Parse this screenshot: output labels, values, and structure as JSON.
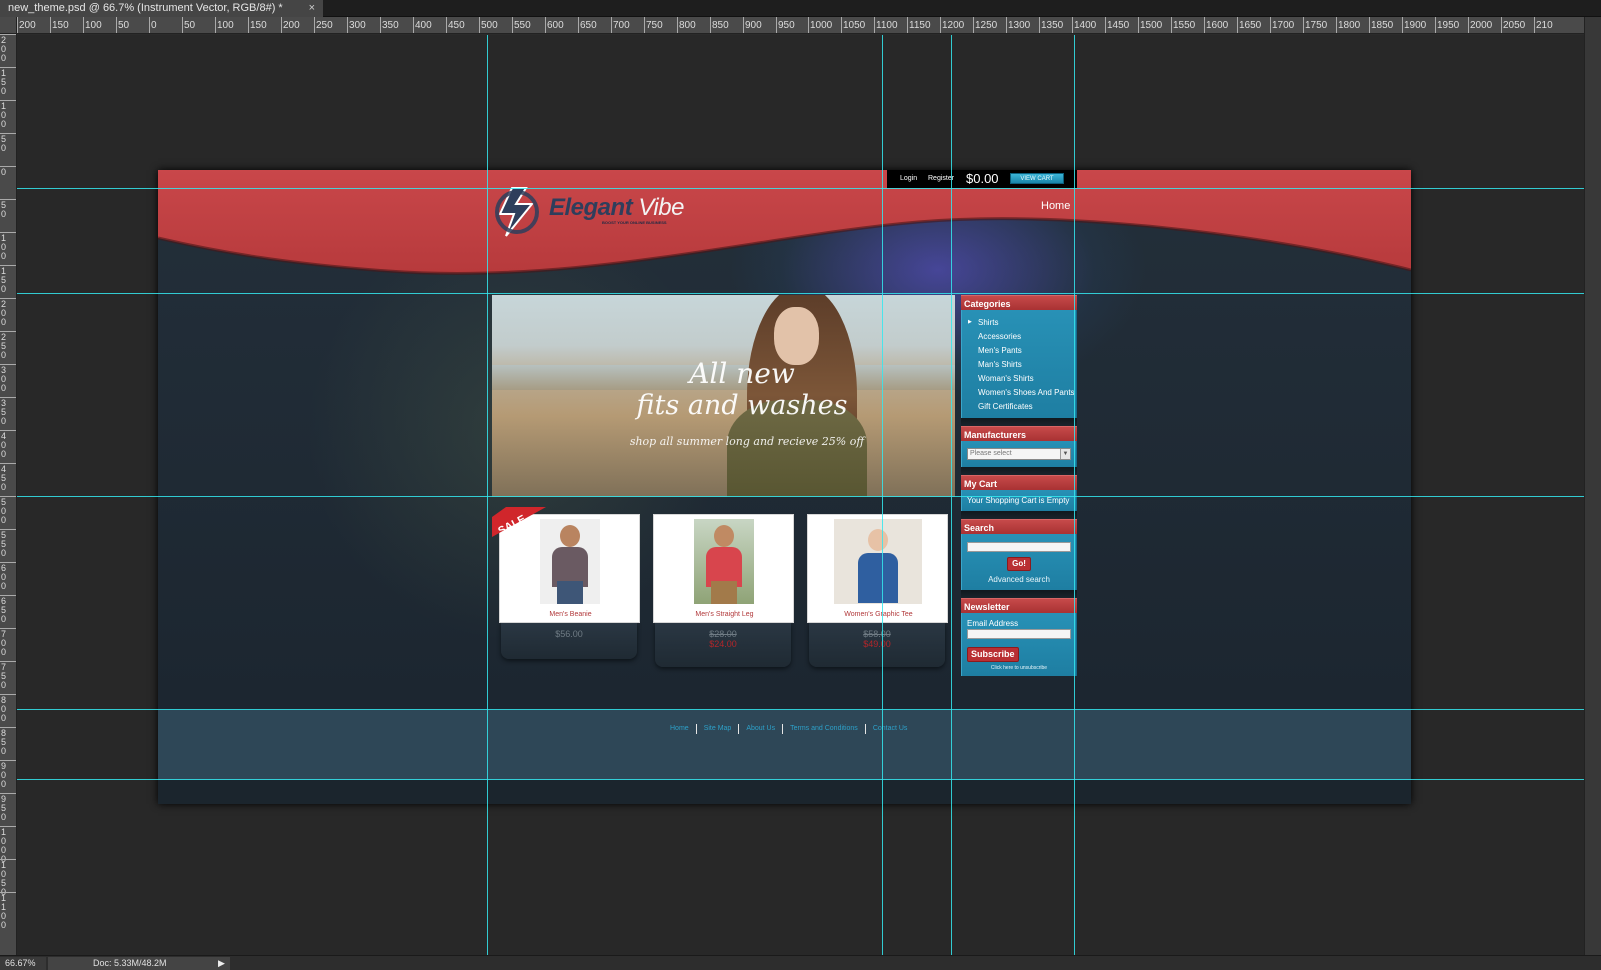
{
  "document": {
    "tab_title": "new_theme.psd @ 66.7% (Instrument Vector, RGB/8#) *",
    "close_glyph": "×"
  },
  "rulers": {
    "horizontal_labels": [
      "200",
      "150",
      "100",
      "50",
      "0",
      "50",
      "100",
      "150",
      "200",
      "250",
      "300",
      "350",
      "400",
      "450",
      "500",
      "550",
      "600",
      "650",
      "700",
      "750",
      "800",
      "850",
      "900",
      "950",
      "1000",
      "1050",
      "1100",
      "1150",
      "1200",
      "1250",
      "1300",
      "1350",
      "1400",
      "1450",
      "1500",
      "1550",
      "1600",
      "1650",
      "1700",
      "1750",
      "1800",
      "1850",
      "1900",
      "1950",
      "2000",
      "2050",
      "210"
    ],
    "vertical_labels": [
      "200",
      "150",
      "100",
      "50",
      "0",
      "50",
      "100",
      "150",
      "200",
      "250",
      "300",
      "350",
      "400",
      "450",
      "500",
      "550",
      "600",
      "650",
      "700",
      "750",
      "800",
      "850",
      "900",
      "950",
      "1000",
      "1050",
      "1100"
    ]
  },
  "site": {
    "topbar": {
      "login": "Login",
      "register": "Register",
      "cart_total": "$0.00",
      "view_cart": "VIEW CART"
    },
    "logo": {
      "word1": "Elegant",
      "word2": " Vibe",
      "tagline": "BOOST YOUR ONLINE BUSINESS"
    },
    "nav": {
      "home": "Home"
    },
    "banner": {
      "line1": "All new",
      "line2": "fits and washes",
      "line3": "shop all summer long and recieve 25% off"
    },
    "sale_badge": "SALE",
    "products": [
      {
        "name": "Men's Beanie",
        "price": "$56.00",
        "old_price": "",
        "shirt": "#6a5a62",
        "pants": "#3e5677"
      },
      {
        "name": "Men's Straight Leg",
        "price": "$24.00",
        "old_price": "$28.00",
        "shirt": "#d8454d",
        "pants": "#a27a4a"
      },
      {
        "name": "Women's Graphic Tee",
        "price": "$49.00",
        "old_price": "$58.00",
        "shirt": "#2f5fa0",
        "pants": "#e4d6c0"
      }
    ],
    "sidebar": {
      "categories_title": "Categories",
      "categories": [
        "Shirts",
        "Accessories",
        "Men's Pants",
        "Man's Shirts",
        "Woman's Shirts",
        "Women's Shoes And Pants",
        "Gift Certificates"
      ],
      "manufacturers_title": "Manufacturers",
      "manufacturers_placeholder": "Please select",
      "mycart_title": "My Cart",
      "cart_empty": "Your Shopping Cart is Empty",
      "search_title": "Search",
      "go": "Go!",
      "advanced_search": "Advanced search",
      "newsletter_title": "Newsletter",
      "email_label": "Email Address",
      "subscribe": "Subscribe",
      "unsubscribe": "Click here to unsubscribe"
    },
    "footer": {
      "links": [
        "Home",
        "Site Map",
        "About Us",
        "Terms and Conditions",
        "Contact Us"
      ]
    }
  },
  "status": {
    "zoom": "66.67%",
    "doc_size": "Doc: 5.33M/48.2M"
  },
  "colors": {
    "header_red": "#c5484a",
    "guide": "#34e7ef",
    "sidebar_blue": "#2891b6"
  }
}
